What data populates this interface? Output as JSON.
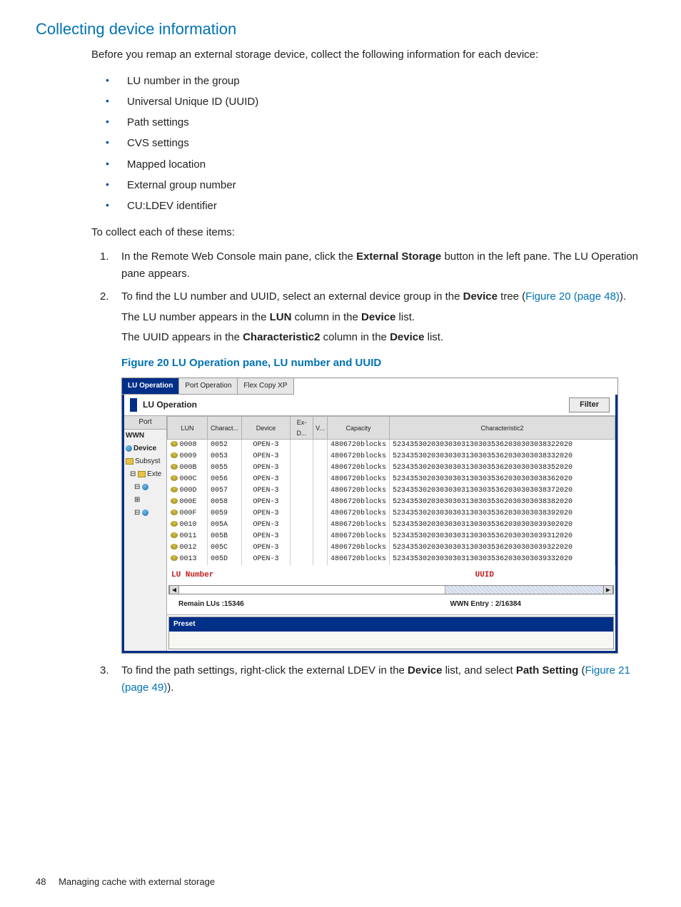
{
  "section": {
    "title": "Collecting device information"
  },
  "intro": "Before you remap an external storage device, collect the following information for each device:",
  "bullets": [
    "LU number in the group",
    "Universal Unique ID (UUID)",
    "Path settings",
    "CVS settings",
    "Mapped location",
    "External group number",
    "CU:LDEV identifier"
  ],
  "collect_line": "To collect each of these items:",
  "steps": {
    "s1": {
      "num": "1.",
      "pre": "In the Remote Web Console main pane, click the ",
      "b1": "External Storage",
      "post": " button in the left pane. The LU Operation pane appears."
    },
    "s2": {
      "num": "2.",
      "pre": "To find the LU number and UUID, select an external device group in the ",
      "b1": "Device",
      "mid": " tree (",
      "link": "Figure 20 (page 48)",
      "post": ").",
      "sub1_pre": "The LU number appears in the ",
      "sub1_b1": "LUN",
      "sub1_mid": " column in the ",
      "sub1_b2": "Device",
      "sub1_post": " list.",
      "sub2_pre": "The UUID appears in the ",
      "sub2_b1": "Characteristic2",
      "sub2_mid": " column in the ",
      "sub2_b2": "Device",
      "sub2_post": " list."
    },
    "s3": {
      "num": "3.",
      "pre": "To find the path settings, right-click the external LDEV in the ",
      "b1": "Device",
      "mid": " list, and select ",
      "b2": "Path Setting",
      "mid2": " (",
      "link": "Figure 21 (page 49)",
      "post": ")."
    }
  },
  "figure": {
    "caption": "Figure 20 LU Operation pane, LU number and UUID"
  },
  "app": {
    "tabs": {
      "t1": "LU Operation",
      "t2": "Port Operation",
      "t3": "Flex Copy XP"
    },
    "pane_title": "LU Operation",
    "filter": "Filter",
    "sidebar": {
      "head": "Port",
      "rows": [
        "WWN",
        "Device",
        "Subsyst",
        "Exte"
      ]
    },
    "columns": [
      "LUN",
      "Charact...",
      "Device",
      "Ex-D...",
      "V...",
      "Capacity",
      "Characteristic2"
    ],
    "rows": [
      {
        "lun": "0008",
        "c": "0052",
        "dev": "OPEN-3",
        "cap": "4806720blocks",
        "c2": "523435302030303031303035362030303038322020"
      },
      {
        "lun": "0009",
        "c": "0053",
        "dev": "OPEN-3",
        "cap": "4806720blocks",
        "c2": "523435302030303031303035362030303038332020"
      },
      {
        "lun": "000B",
        "c": "0055",
        "dev": "OPEN-3",
        "cap": "4806720blocks",
        "c2": "523435302030303031303035362030303038352020"
      },
      {
        "lun": "000C",
        "c": "0056",
        "dev": "OPEN-3",
        "cap": "4806720blocks",
        "c2": "523435302030303031303035362030303038362020"
      },
      {
        "lun": "000D",
        "c": "0057",
        "dev": "OPEN-3",
        "cap": "4806720blocks",
        "c2": "523435302030303031303035362030303038372020"
      },
      {
        "lun": "000E",
        "c": "0058",
        "dev": "OPEN-3",
        "cap": "4806720blocks",
        "c2": "523435302030303031303035362030303038382020"
      },
      {
        "lun": "000F",
        "c": "0059",
        "dev": "OPEN-3",
        "cap": "4806720blocks",
        "c2": "523435302030303031303035362030303038392020"
      },
      {
        "lun": "0010",
        "c": "005A",
        "dev": "OPEN-3",
        "cap": "4806720blocks",
        "c2": "523435302030303031303035362030303039302020"
      },
      {
        "lun": "0011",
        "c": "005B",
        "dev": "OPEN-3",
        "cap": "4806720blocks",
        "c2": "523435302030303031303035362030303039312020"
      },
      {
        "lun": "0012",
        "c": "005C",
        "dev": "OPEN-3",
        "cap": "4806720blocks",
        "c2": "523435302030303031303035362030303039322020"
      },
      {
        "lun": "0013",
        "c": "005D",
        "dev": "OPEN-3",
        "cap": "4806720blocks",
        "c2": "523435302030303031303035362030303039332020"
      }
    ],
    "annot": {
      "left": "LU Number",
      "right": "UUID"
    },
    "info": {
      "left": "Remain LUs :15346",
      "right": "WWN Entry : 2/16384"
    },
    "preset": "Preset"
  },
  "footer": {
    "page": "48",
    "chapter": "Managing cache with external storage"
  }
}
